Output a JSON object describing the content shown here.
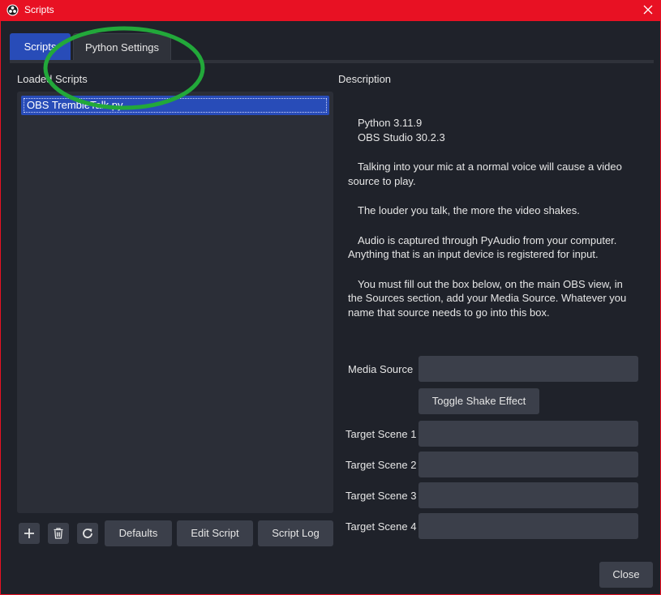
{
  "window": {
    "title": "Scripts"
  },
  "tabs": [
    {
      "label": "Scripts",
      "active": true
    },
    {
      "label": "Python Settings",
      "active": false
    }
  ],
  "loaded_scripts": {
    "label": "Loaded Scripts",
    "items": [
      "OBS TrembleTalk.py"
    ],
    "selected": "OBS TrembleTalk.py"
  },
  "list_buttons": {
    "add_icon": "plus-icon",
    "remove_icon": "trash-icon",
    "reload_icon": "refresh-icon",
    "defaults": "Defaults",
    "edit_script": "Edit Script",
    "script_log": "Script Log"
  },
  "description": {
    "label": "Description",
    "lines": [
      "Python 3.11.9",
      "OBS Studio 30.2.3",
      "Talking into your mic at a normal voice will cause a video",
      "source to play.",
      "The louder you talk, the more the video shakes.",
      "Audio is captured through PyAudio from your computer.",
      "Anything that is an input device is registered for input.",
      "You must fill out the box below, on the main OBS view, in",
      "the Sources section, add your Media Source. Whatever you",
      "name that source needs to go into this box."
    ]
  },
  "settings": {
    "media_source_label": "Media Source",
    "media_source_value": "",
    "toggle_button": "Toggle Shake Effect",
    "target_scenes": [
      {
        "label": "Target Scene 1",
        "value": ""
      },
      {
        "label": "Target Scene 2",
        "value": ""
      },
      {
        "label": "Target Scene 3",
        "value": ""
      },
      {
        "label": "Target Scene 4",
        "value": ""
      }
    ]
  },
  "footer": {
    "close": "Close"
  },
  "colors": {
    "title_bar": "#e81123",
    "background": "#1f222a",
    "accent": "#284cb8",
    "annotation_circle": "#22a83a"
  }
}
